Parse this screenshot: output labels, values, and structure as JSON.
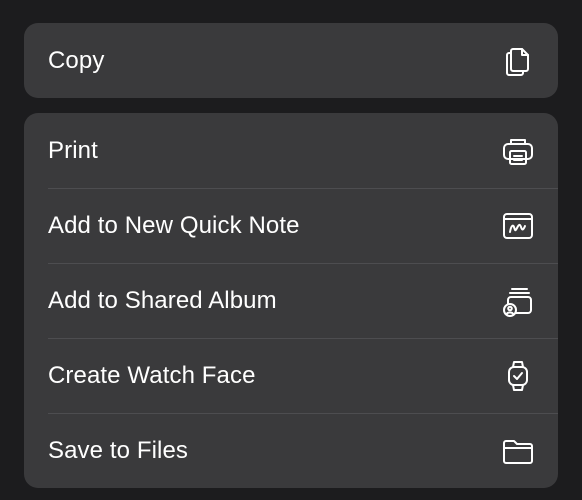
{
  "menu": {
    "top_group": [
      {
        "label": "Copy",
        "icon": "copy-icon"
      }
    ],
    "main_group": [
      {
        "label": "Print",
        "icon": "printer-icon"
      },
      {
        "label": "Add to New Quick Note",
        "icon": "quick-note-icon"
      },
      {
        "label": "Add to Shared Album",
        "icon": "shared-album-icon"
      },
      {
        "label": "Create Watch Face",
        "icon": "watch-icon"
      },
      {
        "label": "Save to Files",
        "icon": "folder-icon"
      }
    ]
  },
  "colors": {
    "background": "#1c1c1e",
    "panel": "#3a3a3c",
    "separator": "#4d4d50",
    "text": "#ffffff"
  }
}
